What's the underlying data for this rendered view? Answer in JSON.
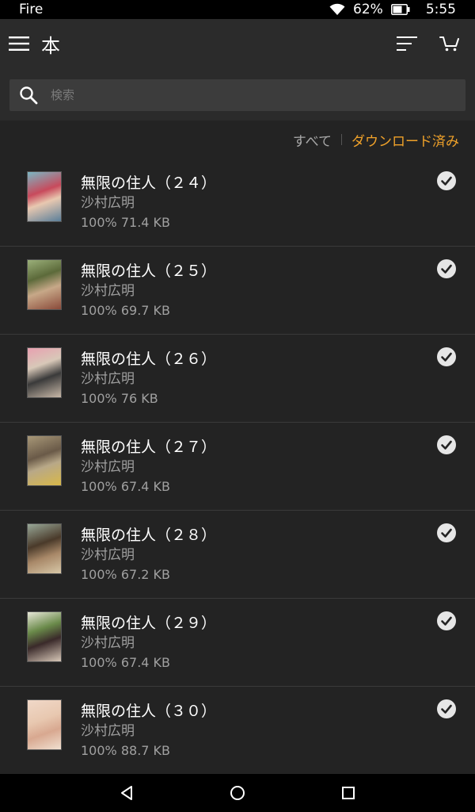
{
  "status_bar": {
    "carrier": "Fire",
    "battery": "62%",
    "time": "5:55"
  },
  "header": {
    "title": "本",
    "search_placeholder": "検索"
  },
  "filters": {
    "all": "すべて",
    "downloaded": "ダウンロード済み",
    "active_color": "#f0a22a"
  },
  "books": [
    {
      "title": "無限の住人（２４）",
      "author": "沙村広明",
      "progress": "100%",
      "size": "71.4 KB",
      "downloaded": true
    },
    {
      "title": "無限の住人（２５）",
      "author": "沙村広明",
      "progress": "100%",
      "size": "69.7 KB",
      "downloaded": true
    },
    {
      "title": "無限の住人（２６）",
      "author": "沙村広明",
      "progress": "100%",
      "size": "76 KB",
      "downloaded": true
    },
    {
      "title": "無限の住人（２７）",
      "author": "沙村広明",
      "progress": "100%",
      "size": "67.4 KB",
      "downloaded": true
    },
    {
      "title": "無限の住人（２８）",
      "author": "沙村広明",
      "progress": "100%",
      "size": "67.2 KB",
      "downloaded": true
    },
    {
      "title": "無限の住人（２９）",
      "author": "沙村広明",
      "progress": "100%",
      "size": "67.4 KB",
      "downloaded": true
    },
    {
      "title": "無限の住人（３０）",
      "author": "沙村広明",
      "progress": "100%",
      "size": "88.7 KB",
      "downloaded": true
    }
  ],
  "icons": {
    "menu": "menu-icon",
    "sort": "sort-icon",
    "cart": "cart-icon",
    "search": "search-icon",
    "downloaded": "check-circle-icon",
    "back": "back-icon",
    "home": "home-icon",
    "recents": "recents-icon"
  }
}
